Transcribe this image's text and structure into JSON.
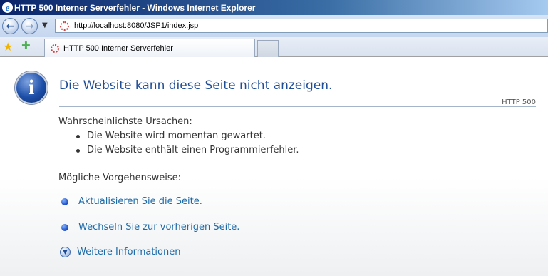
{
  "window": {
    "title": "HTTP 500 Interner Serverfehler - Windows Internet Explorer"
  },
  "toolbar": {
    "address": "http://localhost:8080/JSP1/index.jsp",
    "tab_title": "HTTP 500 Interner Serverfehler"
  },
  "page": {
    "headline": "Die Website kann diese Seite nicht anzeigen.",
    "http_code": "HTTP 500",
    "causes_heading": "Wahrscheinlichste Ursachen:",
    "causes": [
      "Die Website wird momentan gewartet.",
      "Die Website enthält einen Programmierfehler."
    ],
    "actions_heading": "Mögliche Vorgehensweise:",
    "actions": [
      "Aktualisieren Sie die Seite.",
      "Wechseln Sie zur vorherigen Seite.",
      "Weitere Informationen"
    ]
  },
  "icons": [
    "ie-logo-icon",
    "back-icon",
    "forward-icon",
    "favorites-star-icon",
    "add-favorites-icon",
    "page-icon",
    "info-icon",
    "expand-arrow-icon"
  ],
  "colors": {
    "accent": "#1f4e96",
    "link": "#1d6aa8",
    "titlebar": "#0a246a"
  }
}
